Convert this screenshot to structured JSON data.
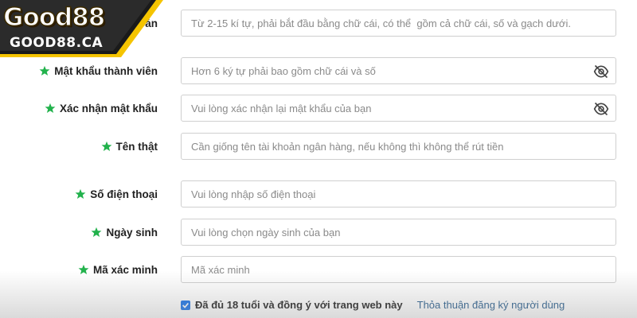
{
  "logo": {
    "main": "Good88",
    "sub": "GOOD88.CA"
  },
  "form": {
    "fields": [
      {
        "label": "Tên tài khoản",
        "label_visible": "oản",
        "placeholder": "Từ 2-15 kí tự, phải bắt đầu bằng chữ cái, có thể  gồm cả chữ cái, số và gạch dưới.",
        "password": false
      },
      {
        "label": "Mật khẩu thành viên",
        "placeholder": "Hơn 6 ký tự phải bao gồm chữ cái và số",
        "password": true
      },
      {
        "label": "Xác nhận mật khẩu",
        "placeholder": "Vui lòng xác nhận lại mật khẩu của bạn",
        "password": true
      },
      {
        "label": "Tên thật",
        "placeholder": "Cần giống tên tài khoản ngân hàng, nếu không thì không thể rút tiền",
        "password": false
      },
      {
        "label": "Số điện thoại",
        "placeholder": "Vui lòng nhập số điện thoại",
        "password": false
      },
      {
        "label": "Ngày sinh",
        "placeholder": "Vui lòng chọn ngày sinh của bạn",
        "password": false
      },
      {
        "label": "Mã xác minh",
        "placeholder": "Mã xác minh",
        "password": false
      }
    ],
    "agree": {
      "checked": true,
      "text": "Đã đủ 18 tuổi và đồng ý với trang web này",
      "link": "Thỏa thuận đăng ký người dùng"
    }
  },
  "colors": {
    "star": "#22b24c",
    "logo_bg": "#1a1a1a",
    "logo_accent": "#f5c400",
    "checkbox": "#1a73e8",
    "link": "#2a5f8f"
  },
  "icons": {
    "required": "star-icon",
    "password_toggle": "eye-slash-icon",
    "checkbox": "checkmark-icon"
  }
}
